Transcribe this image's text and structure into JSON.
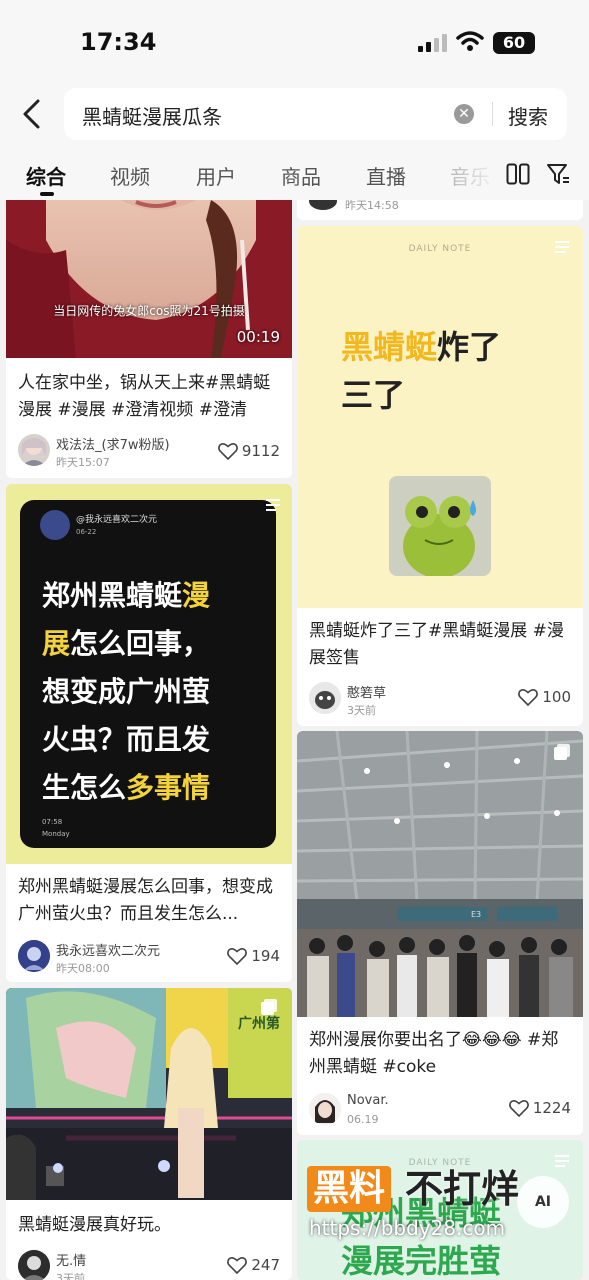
{
  "status": {
    "time": "17:34",
    "battery": "60"
  },
  "search": {
    "query": "黑蜻蜓漫展瓜条",
    "button": "搜索"
  },
  "tabs": [
    "综合",
    "视频",
    "用户",
    "商品",
    "直播",
    "音乐"
  ],
  "cards": [
    {
      "caption": "当日网传的兔女郎cos照为21号拍摄",
      "duration": "00:19",
      "title": "人在家中坐，锅从天上来#黑蜻蜓漫展 #漫展 #澄清视频 #澄清",
      "author": "戏法法_(求7w粉版)",
      "date": "昨天15:07",
      "likes": "9112"
    },
    {
      "phone_user": "@我永远喜欢二次元",
      "phone_date": "06-22",
      "poster_line1": "郑州黑蜻蜓",
      "poster_hl1": "漫",
      "poster_line2_hl": "展",
      "poster_line2": "怎么回事，",
      "poster_line3": "想变成广州萤",
      "poster_line4": "火虫？而且发",
      "poster_line5": "生怎么",
      "poster_hl5": "多事情",
      "phone_time": "07:58",
      "phone_day": "Monday",
      "title": "郑州黑蜻蜓漫展怎么回事，想变成广州萤火虫？而且发生怎么...",
      "author": "我永远喜欢二次元",
      "date": "昨天08:00",
      "likes": "194"
    },
    {
      "title": "黑蜻蜓漫展真好玩。",
      "author": "无.情",
      "date": "3天前",
      "likes": "247"
    },
    {
      "date": "昨天14:58"
    },
    {
      "note_label": "DAILY NOTE",
      "headline_hl": "黑蜻蜓",
      "headline": "炸了",
      "headline2": "三了",
      "title": "黑蜻蜓炸了三了#黑蜻蜓漫展 #漫展签售",
      "author": "憨箬草",
      "date": "3天前",
      "likes": "100"
    },
    {
      "hall_sign": "E3",
      "title": "郑州漫展你要出名了😂😂😂 #郑州黑蜻蜓 #coke",
      "author": "Novar.",
      "date": "06.19",
      "likes": "1224"
    },
    {
      "note_label": "DAILY NOTE",
      "headline": "郑州黑蜻蜓",
      "headline2": "漫展完胜萤"
    }
  ],
  "watermark": {
    "brand1": "黑料",
    "brand2": "不打烊",
    "url": "https://bbdy28.com",
    "badge": "AI"
  },
  "colors": {
    "accent_yellow": "#f3d33d",
    "poster_black": "#111111",
    "note_bg": "#fbf3c4",
    "heart": "#444444"
  }
}
